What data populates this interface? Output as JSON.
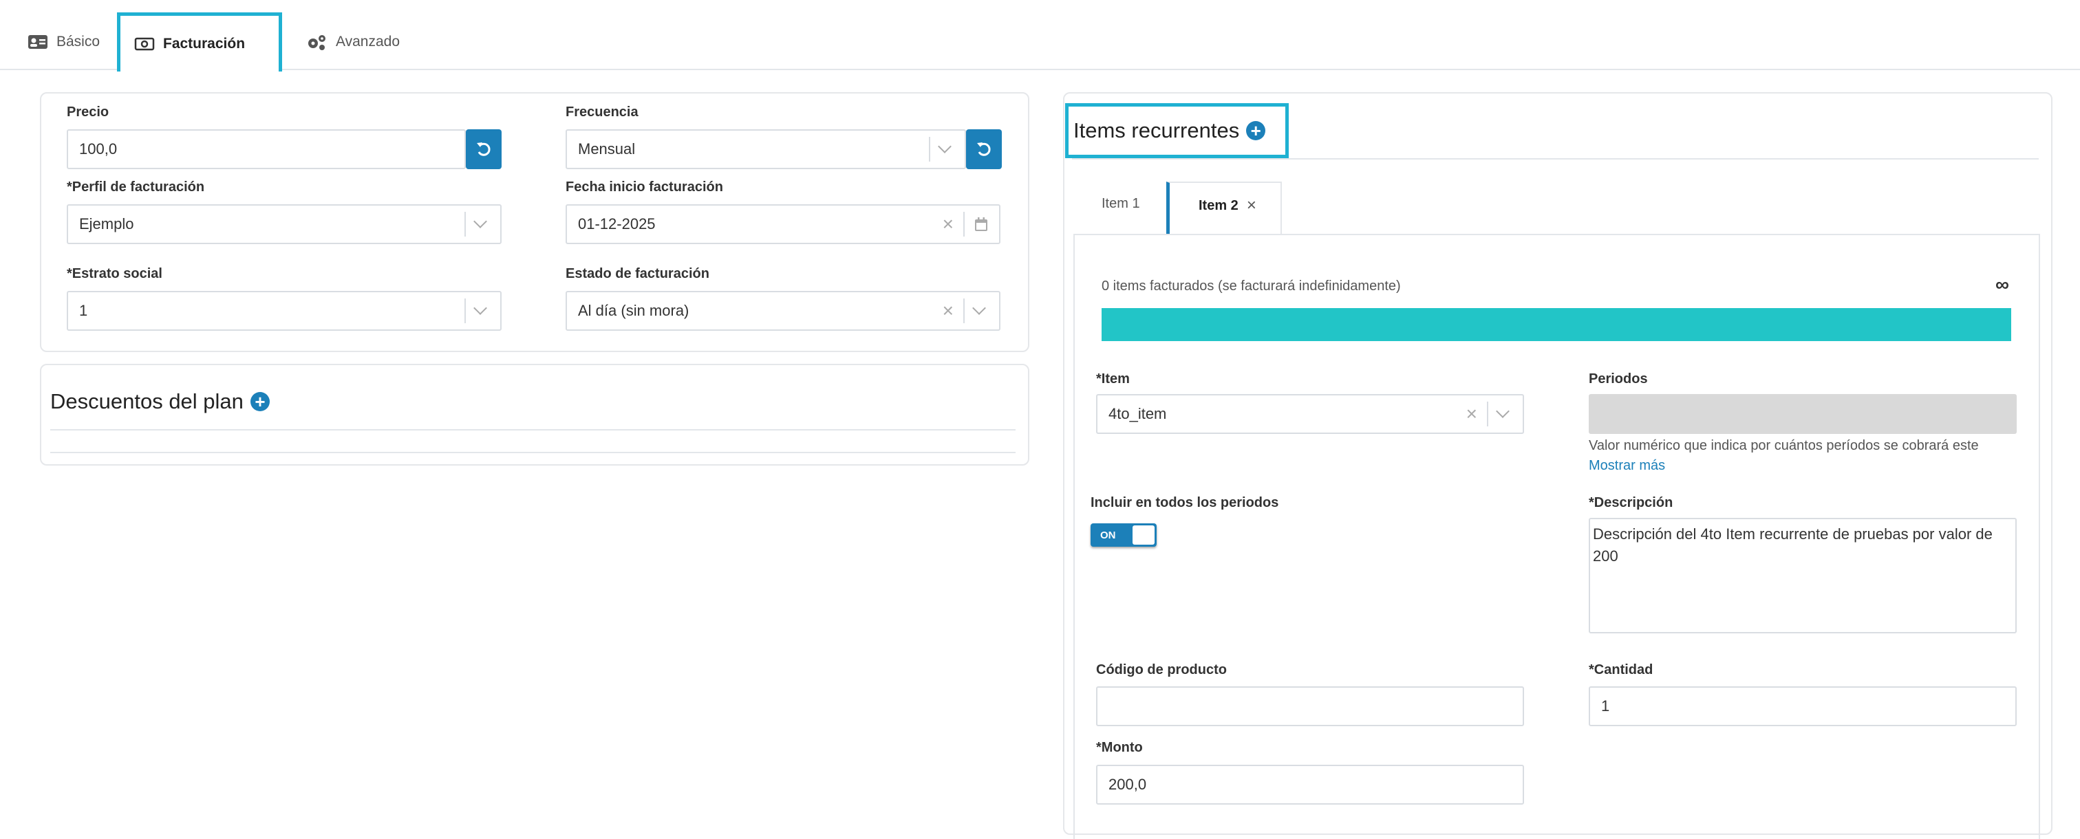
{
  "tabs": [
    {
      "label": "Básico",
      "icon": "id-card-icon"
    },
    {
      "label": "Facturación",
      "icon": "money-icon"
    },
    {
      "label": "Avanzado",
      "icon": "gears-icon"
    }
  ],
  "billing": {
    "precio": {
      "label": "Precio",
      "value": "100,0"
    },
    "frecuencia": {
      "label": "Frecuencia",
      "value": "Mensual"
    },
    "perfil": {
      "req": "*",
      "label": "Perfil de facturación",
      "value": "Ejemplo"
    },
    "fecha": {
      "label": "Fecha inicio facturación",
      "value": "01-12-2025"
    },
    "estrato": {
      "req": "*",
      "label": "Estrato social",
      "value": "1"
    },
    "estado": {
      "label": "Estado de facturación",
      "value": "Al día (sin mora)"
    }
  },
  "descuentos": {
    "title": "Descuentos del plan"
  },
  "items": {
    "title": "Items recurrentes",
    "tabs": [
      "Item 1",
      "Item 2"
    ],
    "close_symbol": "×",
    "status_text": "0 items facturados (se facturará indefinidamente)",
    "infinity": "∞",
    "progress_fraction": 1.0,
    "progress_color": "#22c5c7",
    "item": {
      "req": "*",
      "label": "Item",
      "value": "4to_item"
    },
    "periodos": {
      "label": "Periodos",
      "help": "Valor numérico que indica por cuántos períodos se cobrará este",
      "more": "Mostrar más"
    },
    "incluir": {
      "label": "Incluir en todos los periodos",
      "toggle": "ON"
    },
    "descripcion": {
      "req": "*",
      "label": "Descripción",
      "value": "Descripción del 4to Item recurrente de pruebas por valor de 200"
    },
    "codigo": {
      "label": "Código de producto",
      "value": ""
    },
    "cantidad": {
      "req": "*",
      "label": "Cantidad",
      "value": "1"
    },
    "monto": {
      "req": "*",
      "label": "Monto",
      "value": "200,0"
    }
  }
}
